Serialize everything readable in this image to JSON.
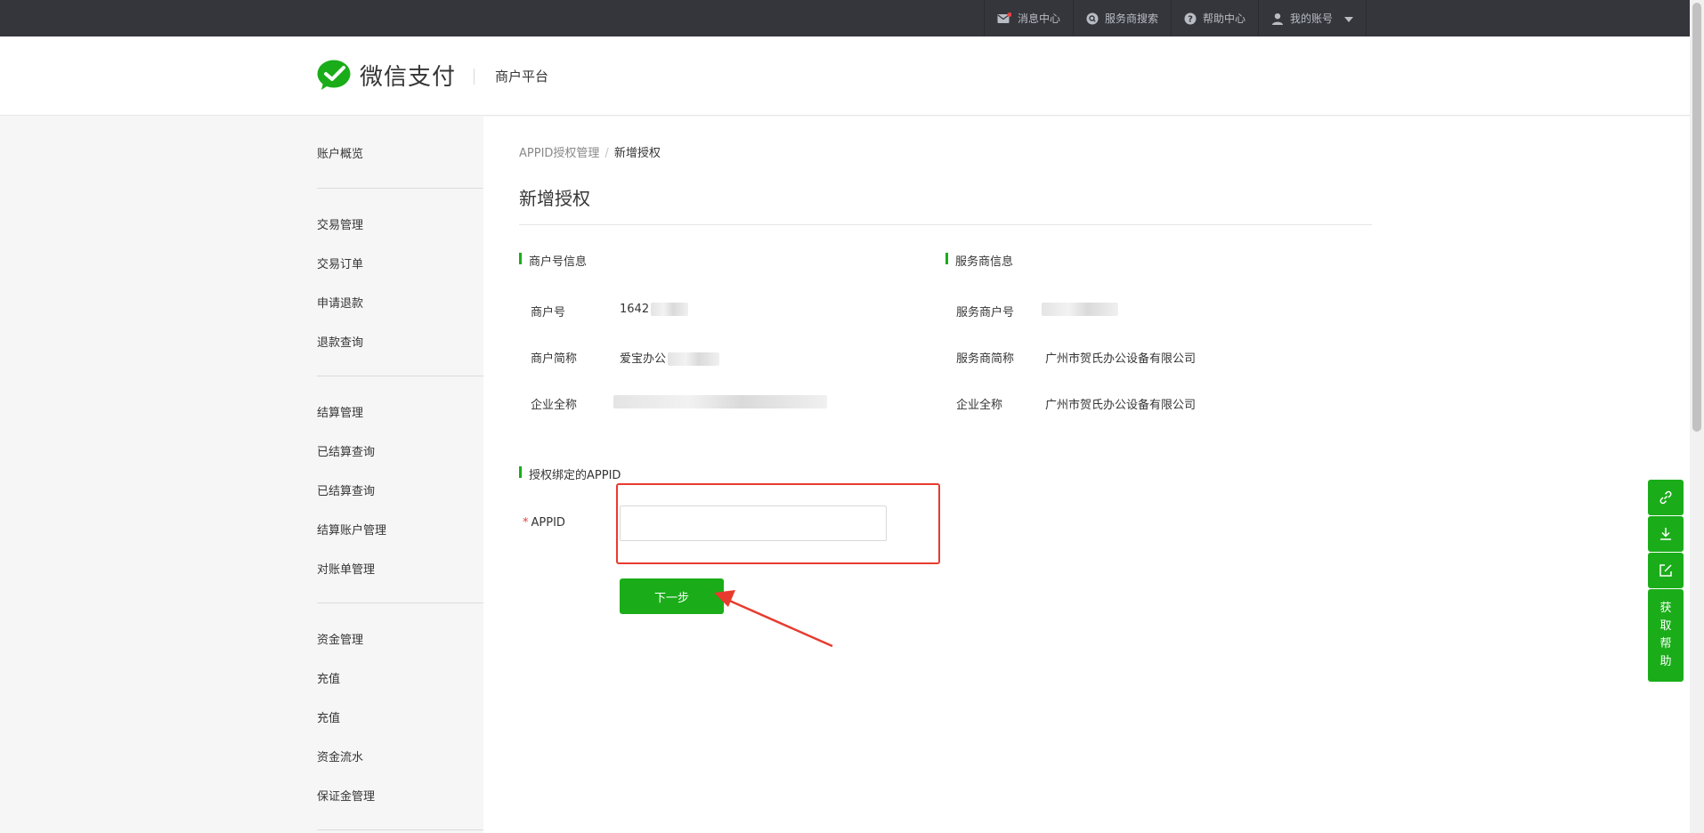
{
  "topnav": [
    {
      "label": "消息中心",
      "icon": "envelope-icon"
    },
    {
      "label": "服务商搜索",
      "icon": "search-icon"
    },
    {
      "label": "帮助中心",
      "icon": "help-icon"
    },
    {
      "label": "我的账号",
      "icon": "user-icon"
    }
  ],
  "brand": {
    "name": "微信支付",
    "platform": "商户平台"
  },
  "sidebar": {
    "items": [
      "账户概览",
      "交易管理",
      "交易订单",
      "申请退款",
      "退款查询",
      "结算管理",
      "已结算查询",
      "已结算查询",
      "结算账户管理",
      "对账单管理",
      "资金管理",
      "充值",
      "充值",
      "资金流水",
      "保证金管理"
    ]
  },
  "breadcrumb": {
    "parent": "APPID授权管理",
    "sep": "/",
    "current": "新增授权"
  },
  "page": {
    "title": "新增授权"
  },
  "merchant": {
    "section": "商户号信息",
    "id_label": "商户号",
    "id_value": "1642",
    "short_label": "商户简称",
    "short_value": "爱宝办公",
    "full_label": "企业全称"
  },
  "provider": {
    "section": "服务商信息",
    "id_label": "服务商户号",
    "short_label": "服务商简称",
    "short_value": "广州市贺氏办公设备有限公司",
    "full_label": "企业全称",
    "full_value": "广州市贺氏办公设备有限公司"
  },
  "appid": {
    "section": "授权绑定的APPID",
    "required": "*",
    "label": "APPID",
    "value": "",
    "placeholder": ""
  },
  "actions": {
    "next": "下一步"
  },
  "float_tools": {
    "help": "获取帮助"
  },
  "colors": {
    "brand_green": "#1aad19",
    "topbar": "#34363c",
    "highlight_red": "#e83b2e"
  }
}
